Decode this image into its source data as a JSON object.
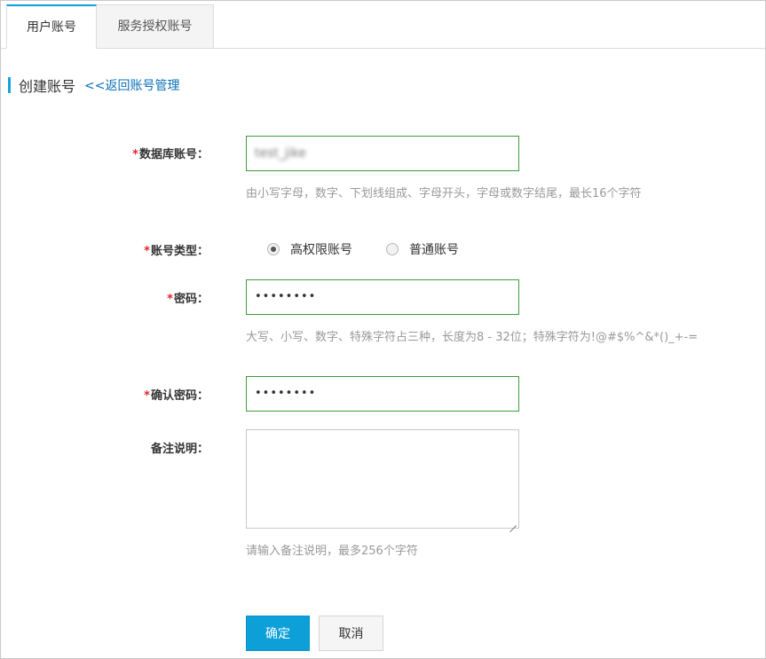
{
  "tabs": [
    {
      "label": "用户账号",
      "active": true
    },
    {
      "label": "服务授权账号",
      "active": false
    }
  ],
  "header": {
    "title": "创建账号",
    "back_link": "<<返回账号管理"
  },
  "form": {
    "db_account": {
      "required_mark": "*",
      "label": "数据库账号：",
      "value": "test_jike",
      "hint": "由小写字母，数字、下划线组成、字母开头，字母或数字结尾，最长16个字符"
    },
    "account_type": {
      "required_mark": "*",
      "label": "账号类型：",
      "options": [
        {
          "label": "高权限账号",
          "selected": true
        },
        {
          "label": "普通账号",
          "selected": false
        }
      ]
    },
    "password": {
      "required_mark": "*",
      "label": "密码：",
      "value": "••••••••",
      "hint": "大写、小写、数字、特殊字符占三种，长度为8 - 32位；特殊字符为!@#$%^&*()_+-="
    },
    "confirm_password": {
      "required_mark": "*",
      "label": "确认密码：",
      "value": "••••••••"
    },
    "remark": {
      "label": "备注说明：",
      "value": "",
      "hint": "请输入备注说明，最多256个字符"
    }
  },
  "buttons": {
    "ok": "确定",
    "cancel": "取消"
  },
  "colors": {
    "accent": "#0d9fd8",
    "valid_border": "#3c9d3c",
    "required": "#e4252a",
    "link": "#0b6fb8"
  }
}
